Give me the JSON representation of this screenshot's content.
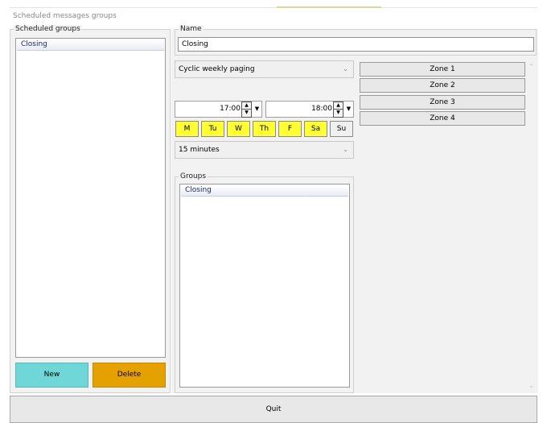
{
  "window": {
    "title": "Scheduled messages groups"
  },
  "scheduled_groups": {
    "legend": "Scheduled groups",
    "items": [
      "Closing"
    ],
    "new_label": "New",
    "delete_label": "Delete"
  },
  "name": {
    "legend": "Name",
    "value": "Closing"
  },
  "mode": {
    "selected": "Cyclic weekly paging"
  },
  "time": {
    "start": "17:00",
    "end": "18:00"
  },
  "days": [
    {
      "label": "M",
      "active": true
    },
    {
      "label": "Tu",
      "active": true
    },
    {
      "label": "W",
      "active": true
    },
    {
      "label": "Th",
      "active": true
    },
    {
      "label": "F",
      "active": true
    },
    {
      "label": "Sa",
      "active": true
    },
    {
      "label": "Su",
      "active": false
    }
  ],
  "interval": {
    "selected": "15 minutes"
  },
  "groups": {
    "legend": "Groups",
    "items": [
      "Closing"
    ]
  },
  "zones": [
    "Zone 1",
    "Zone 2",
    "Zone 3",
    "Zone 4"
  ],
  "footer": {
    "quit_label": "Quit"
  },
  "colors": {
    "new_button": "#6fd7d7",
    "delete_button": "#e5a100",
    "day_active": "#ffff33"
  }
}
